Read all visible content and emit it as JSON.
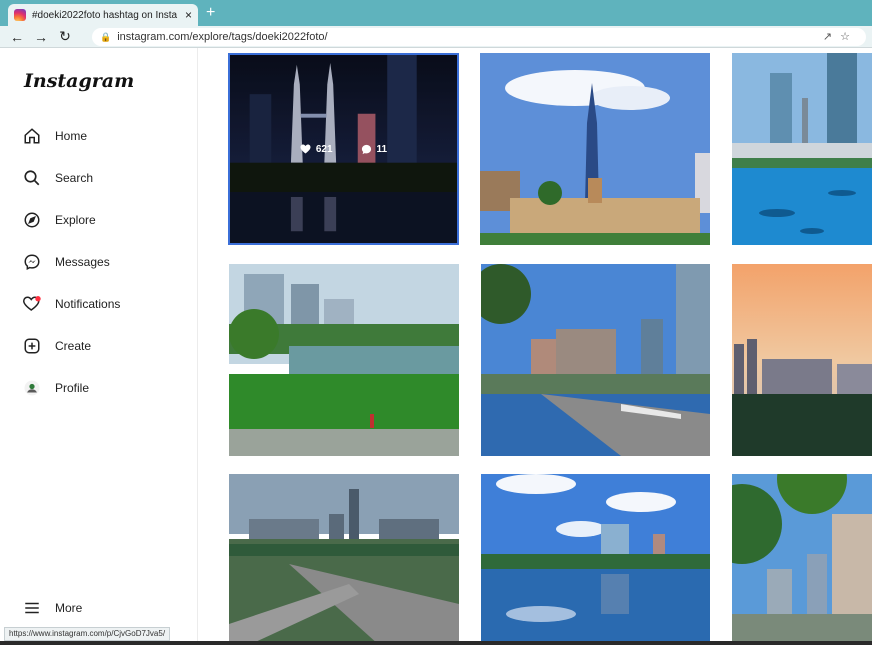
{
  "browser": {
    "tab_title": "#doeki2022foto hashtag on Insta",
    "tab_close": "×",
    "new_tab": "+",
    "url": "instagram.com/explore/tags/doeki2022foto/",
    "status_url": "https://www.instagram.com/p/CjvGoD7Jva5/",
    "icons": [
      "back-arrow-icon",
      "forward-arrow-icon",
      "reload-icon",
      "lock-icon",
      "share-icon",
      "star-icon"
    ]
  },
  "sidebar": {
    "logo": "Instagram",
    "items": [
      {
        "label": "Home",
        "icon": "home-icon"
      },
      {
        "label": "Search",
        "icon": "search-icon"
      },
      {
        "label": "Explore",
        "icon": "compass-icon"
      },
      {
        "label": "Messages",
        "icon": "messenger-icon"
      },
      {
        "label": "Notifications",
        "icon": "heart-icon"
      },
      {
        "label": "Create",
        "icon": "plus-square-icon"
      },
      {
        "label": "Profile",
        "icon": "avatar-icon"
      }
    ],
    "more": {
      "label": "More",
      "icon": "hamburger-icon"
    }
  },
  "grid": {
    "hover": {
      "likes": "621",
      "comments": "11"
    },
    "photos": [
      {
        "subject": "Petronas towers at night",
        "colors": [
          "#0b0f1e",
          "#1a2447",
          "#3a4a7a"
        ]
      },
      {
        "subject": "Merdeka 118 and Sultan Abdul Samad building",
        "colors": [
          "#5d8fd8",
          "#8ab8ee",
          "#c9a87a"
        ]
      },
      {
        "subject": "KL skyline over blue pool",
        "colors": [
          "#6fa9d8",
          "#3aa0d8",
          "#0f6da8"
        ]
      },
      {
        "subject": "Park lake with skyline and runner",
        "colors": [
          "#b7cfdc",
          "#4a8a4a",
          "#2f7a2a"
        ]
      },
      {
        "subject": "River of Life with skyscrapers",
        "colors": [
          "#3f7fd0",
          "#6aa3e0",
          "#5a5a6a"
        ]
      },
      {
        "subject": "Sunset KL skyline over trees",
        "colors": [
          "#f3a26a",
          "#8a8a9a",
          "#1f3a2a"
        ]
      },
      {
        "subject": "Aerial highway and skyline",
        "colors": [
          "#8aa0b4",
          "#4a6a5a",
          "#2f5a3a"
        ]
      },
      {
        "subject": "Putrajaya reflection lake",
        "colors": [
          "#3f7fd8",
          "#e8f0fa",
          "#2a6ab0"
        ]
      },
      {
        "subject": "Skyscrapers framed by trees",
        "colors": [
          "#5a9ad8",
          "#2f6a2f",
          "#8aa0b8"
        ]
      }
    ]
  }
}
